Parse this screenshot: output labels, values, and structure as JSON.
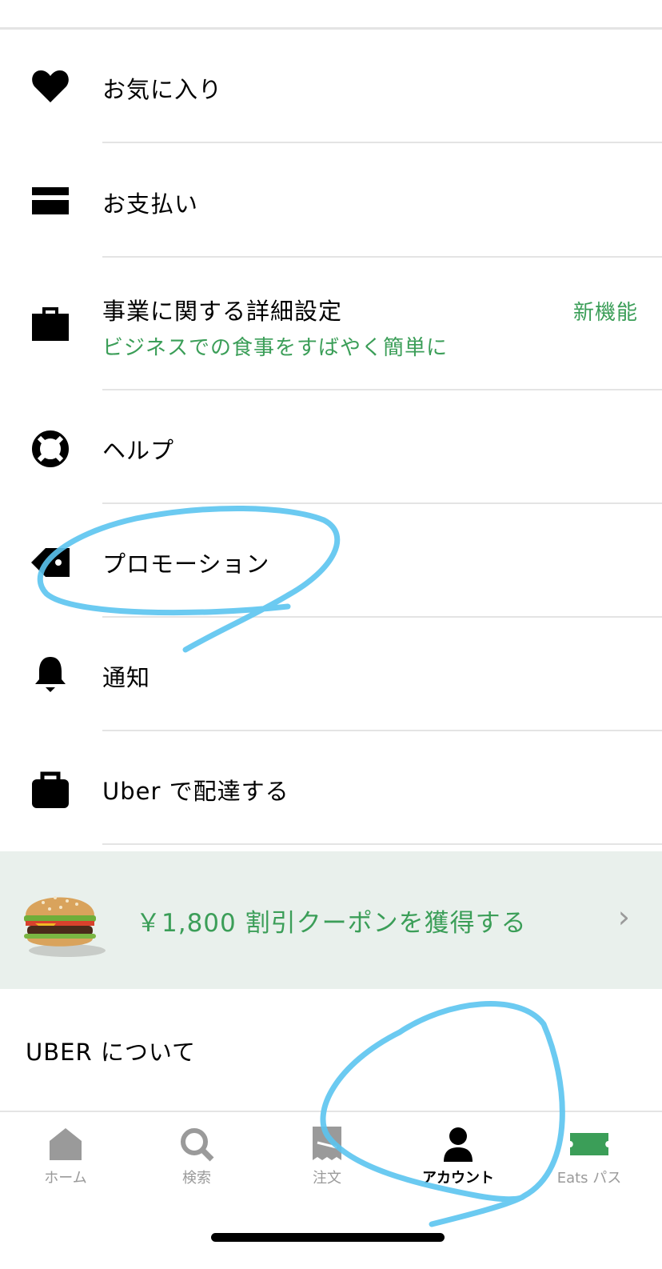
{
  "menu": {
    "favorites": {
      "label": "お気に入り",
      "icon": "heart-icon"
    },
    "payment": {
      "label": "お支払い",
      "icon": "credit-card-icon"
    },
    "business": {
      "label": "事業に関する詳細設定",
      "sublabel": "ビジネスでの食事をすばやく簡単に",
      "badge": "新機能",
      "icon": "briefcase-icon"
    },
    "help": {
      "label": "ヘルプ",
      "icon": "lifebuoy-icon"
    },
    "promotions": {
      "label": "プロモーション",
      "icon": "tag-icon"
    },
    "notifications": {
      "label": "通知",
      "icon": "bell-icon"
    },
    "deliver": {
      "label": "Uber で配達する",
      "icon": "bag-icon"
    }
  },
  "promo_banner": {
    "text": "￥1,800 割引クーポンを獲得する",
    "chevron": "›",
    "image": "burger-image"
  },
  "about": {
    "label": "UBER について"
  },
  "tabbar": {
    "tabs": [
      {
        "label": "ホーム",
        "icon": "home-icon",
        "active": false
      },
      {
        "label": "検索",
        "icon": "search-icon",
        "active": false
      },
      {
        "label": "注文",
        "icon": "receipt-icon",
        "active": false
      },
      {
        "label": "アカウント",
        "icon": "person-icon",
        "active": true
      },
      {
        "label": "Eats パス",
        "icon": "ticket-icon",
        "active": false
      }
    ]
  },
  "colors": {
    "accent_green": "#3b9e58",
    "banner_bg": "#e9f0ec",
    "inactive_gray": "#9a9a9a",
    "annotation_blue": "#5bc4ef"
  }
}
